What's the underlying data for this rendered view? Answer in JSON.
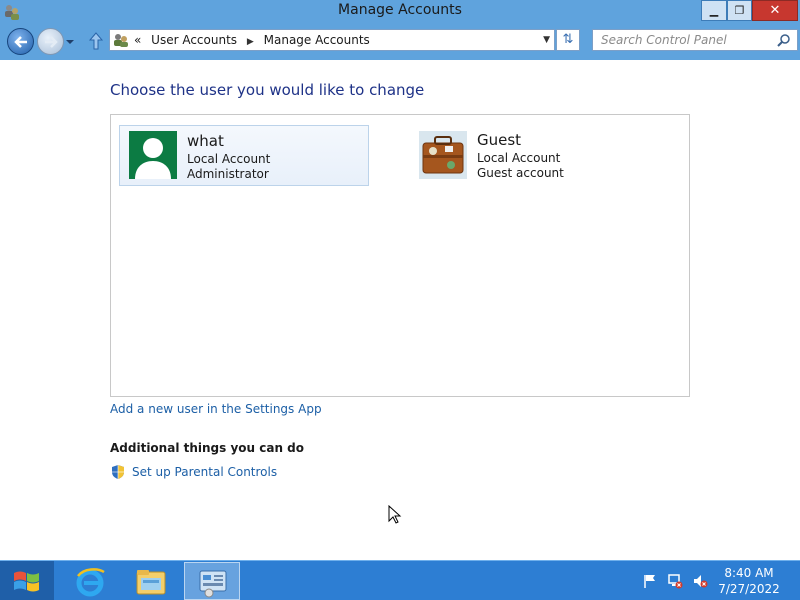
{
  "window": {
    "title": "Manage Accounts"
  },
  "address": {
    "crumbs": [
      "User Accounts",
      "Manage Accounts"
    ],
    "overflow": "«"
  },
  "search": {
    "placeholder": "Search Control Panel"
  },
  "main": {
    "heading": "Choose the user you would like to change",
    "users": [
      {
        "name": "what",
        "type": "Local Account",
        "role": "Administrator",
        "picture": "default-user-avatar"
      },
      {
        "name": "Guest",
        "type": "Local Account",
        "role": "Guest account",
        "picture": "suitcase-avatar"
      }
    ],
    "add_user_link": "Add a new user in the Settings App",
    "additional_heading": "Additional things you can do",
    "parental_link": "Set up Parental Controls"
  },
  "taskbar": {
    "apps": [
      "internet-explorer-icon",
      "file-explorer-icon",
      "control-panel-icon"
    ],
    "clock": {
      "time": "8:40 AM",
      "date": "7/27/2022"
    }
  },
  "colors": {
    "accent": "#5fa3dd",
    "link": "#1c5fa6",
    "heading": "#1e3287",
    "taskbar": "#2d7ed3"
  }
}
